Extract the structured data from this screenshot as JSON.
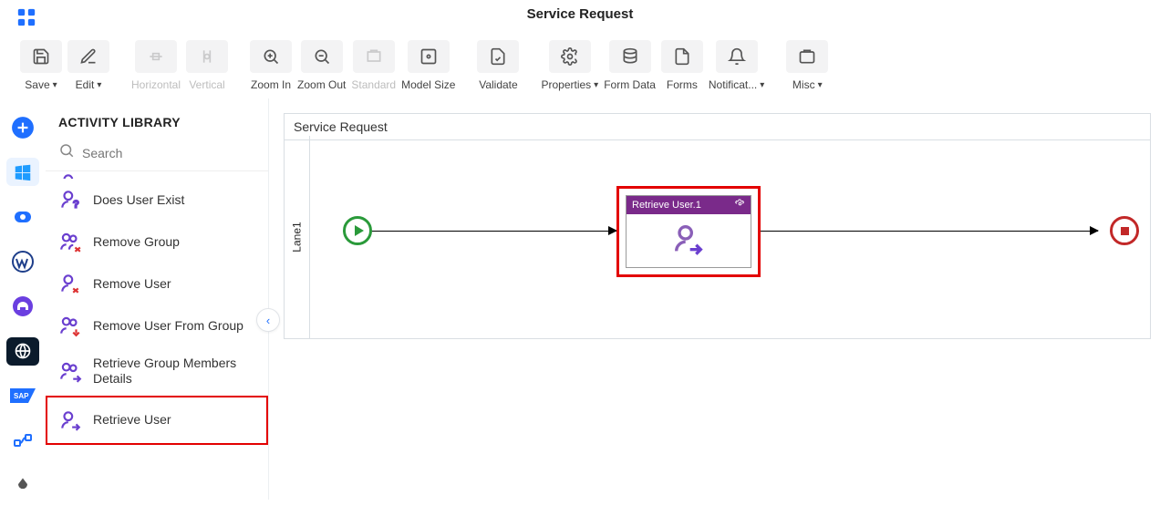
{
  "header": {
    "title": "Service Request"
  },
  "toolbar": {
    "save": "Save",
    "edit": "Edit",
    "horizontal": "Horizontal",
    "vertical": "Vertical",
    "zoom_in": "Zoom In",
    "zoom_out": "Zoom Out",
    "standard": "Standard",
    "model_size": "Model Size",
    "validate": "Validate",
    "properties": "Properties",
    "form_data": "Form Data",
    "forms": "Forms",
    "notifications": "Notificat...",
    "misc": "Misc"
  },
  "panel": {
    "title": "ACTIVITY LIBRARY",
    "search_placeholder": "Search",
    "items": [
      {
        "label": "Does User Exist"
      },
      {
        "label": "Remove Group"
      },
      {
        "label": "Remove User"
      },
      {
        "label": "Remove User From Group"
      },
      {
        "label": "Retrieve Group Members Details"
      },
      {
        "label": "Retrieve User"
      }
    ]
  },
  "canvas": {
    "title": "Service Request",
    "lane": "Lane1",
    "activity_title": "Retrieve User.1"
  },
  "colors": {
    "brand_purple": "#7a2a8a",
    "highlight": "#e30000",
    "blue": "#1f6fff"
  }
}
